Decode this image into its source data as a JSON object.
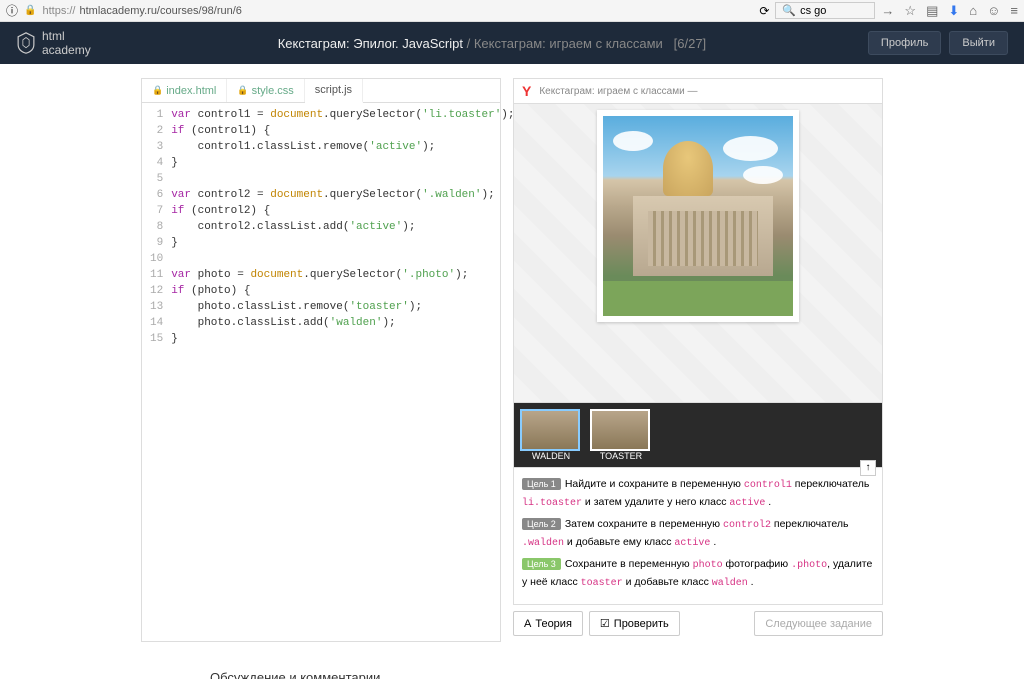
{
  "browser": {
    "url_prefix": "https://",
    "url": "htmlacademy.ru/courses/98/run/6",
    "search": "cs go"
  },
  "header": {
    "logo_top": "html",
    "logo_bottom": "academy",
    "course": "Кекстаграм: Эпилог. JavaScript",
    "lesson": "Кекстаграм: играем с классами",
    "progress": "[6/27]",
    "profile": "Профиль",
    "logout": "Выйти"
  },
  "tabs": {
    "html": "index.html",
    "css": "style.css",
    "js": "script.js"
  },
  "code_lines": [
    "var control1 = document.querySelector('li.toaster');",
    "if (control1) {",
    "    control1.classList.remove('active');",
    "}",
    "",
    "var control2 = document.querySelector('.walden');",
    "if (control2) {",
    "    control2.classList.add('active');",
    "}",
    "",
    "var photo = document.querySelector('.photo');",
    "if (photo) {",
    "    photo.classList.remove('toaster');",
    "    photo.classList.add('walden');",
    "}"
  ],
  "preview": {
    "topbar_text": "Кекстаграм: играем с классами —",
    "filters": [
      {
        "name": "WALDEN",
        "active": true
      },
      {
        "name": "TOASTER",
        "active": false
      }
    ]
  },
  "goals": {
    "g1_label": "Цель 1",
    "g1_text_a": "Найдите и сохраните в переменную ",
    "g1_code_a": "control1",
    "g1_text_b": " переключатель ",
    "g1_code_b": "li.toaster",
    "g1_text_c": " и затем удалите у него класс ",
    "g1_code_c": "active",
    "g2_label": "Цель 2",
    "g2_text_a": "Затем сохраните в переменную ",
    "g2_code_a": "control2",
    "g2_text_b": " переключатель ",
    "g2_code_b": ".walden",
    "g2_text_c": " и добавьте ему класс ",
    "g2_code_c": "active",
    "g3_label": "Цель 3",
    "g3_text_a": "Сохраните в переменную ",
    "g3_code_a": "photo",
    "g3_text_b": " фотографию ",
    "g3_code_b": ".photo",
    "g3_text_c": ", удалите у неё класс ",
    "g3_code_c": "toaster",
    "g3_text_d": " и добавьте класс ",
    "g3_code_d": "walden"
  },
  "actions": {
    "theory": "Теория",
    "check": "Проверить",
    "next": "Следующее задание"
  },
  "footer": "Обсуждение и комментарии"
}
